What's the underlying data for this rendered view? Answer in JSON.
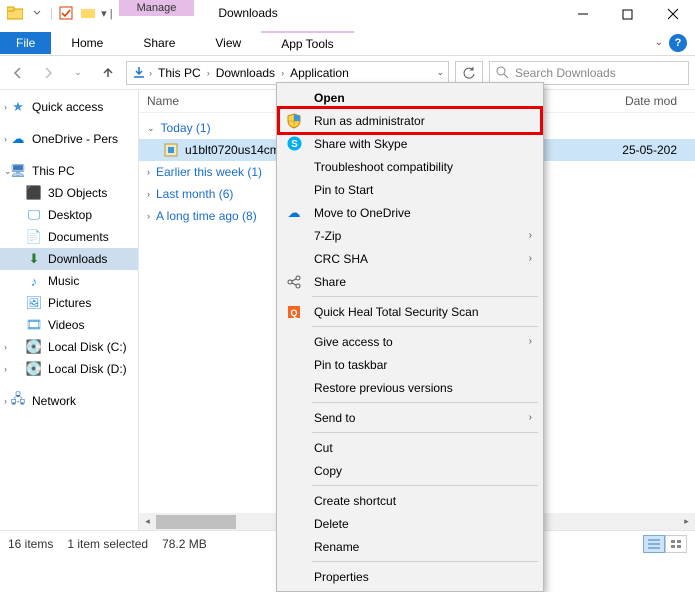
{
  "titlebar": {
    "manage": "Manage",
    "title": "Downloads"
  },
  "ribbon": {
    "file": "File",
    "tabs": [
      "Home",
      "Share",
      "View"
    ],
    "contextual": "App Tools"
  },
  "breadcrumb": [
    "This PC",
    "Downloads",
    "Application"
  ],
  "search": {
    "placeholder": "Search Downloads"
  },
  "sidebar": {
    "quick_access": "Quick access",
    "onedrive": "OneDrive - Pers",
    "this_pc": "This PC",
    "children": [
      "3D Objects",
      "Desktop",
      "Documents",
      "Downloads",
      "Music",
      "Pictures",
      "Videos",
      "Local Disk (C:)",
      "Local Disk (D:)"
    ],
    "network": "Network"
  },
  "columns": {
    "name": "Name",
    "date": "Date mod"
  },
  "groups": [
    {
      "label": "Today (1)",
      "items": [
        {
          "name": "u1blt0720us14cmp",
          "date": "25-05-202"
        }
      ]
    },
    {
      "label": "Earlier this week (1)"
    },
    {
      "label": "Last month (6)"
    },
    {
      "label": "A long time ago (8)"
    }
  ],
  "context_menu": {
    "open": "Open",
    "run_admin": "Run as administrator",
    "skype": "Share with Skype",
    "compat": "Troubleshoot compatibility",
    "pin_start": "Pin to Start",
    "onedrive": "Move to OneDrive",
    "sevenzip": "7-Zip",
    "crc": "CRC SHA",
    "share": "Share",
    "quickheal": "Quick Heal Total Security Scan",
    "give_access": "Give access to",
    "pin_taskbar": "Pin to taskbar",
    "restore": "Restore previous versions",
    "send_to": "Send to",
    "cut": "Cut",
    "copy": "Copy",
    "shortcut": "Create shortcut",
    "delete": "Delete",
    "rename": "Rename",
    "properties": "Properties"
  },
  "status": {
    "items": "16 items",
    "selected": "1 item selected",
    "size": "78.2 MB"
  }
}
